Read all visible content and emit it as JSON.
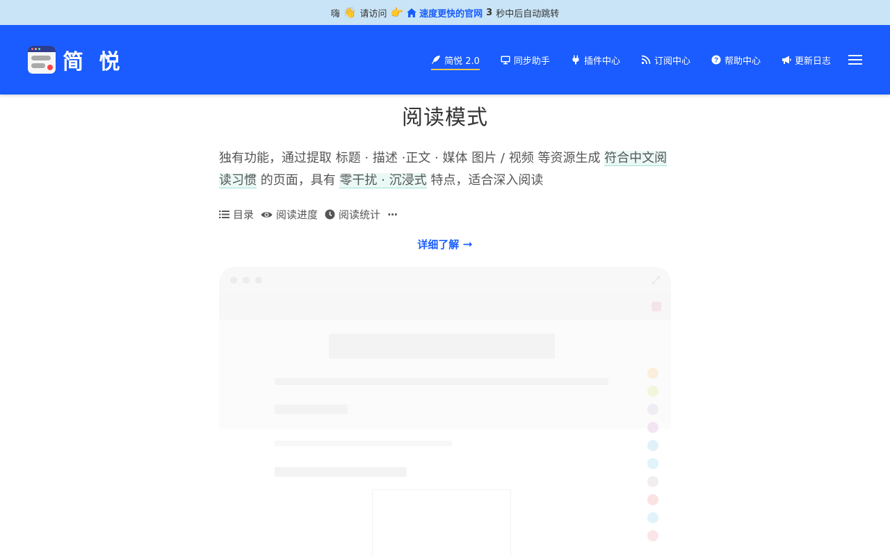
{
  "notice": {
    "greet": "嗨",
    "wave_emoji": "👋",
    "visit": "请访问",
    "point_emoji": "👉",
    "link_text": "速度更快的官网",
    "countdown": "3",
    "suffix": "秒中后自动跳转"
  },
  "brand": {
    "name": "简 悦"
  },
  "nav": {
    "items": [
      {
        "label": "简悦 2.0",
        "icon": "feather-icon"
      },
      {
        "label": "同步助手",
        "icon": "desktop-icon"
      },
      {
        "label": "插件中心",
        "icon": "plug-icon"
      },
      {
        "label": "订阅中心",
        "icon": "rss-icon"
      },
      {
        "label": "帮助中心",
        "icon": "question-circle-icon"
      },
      {
        "label": "更新日志",
        "icon": "megaphone-icon"
      }
    ],
    "active_index": 0
  },
  "page": {
    "title": "阅读模式",
    "desc": {
      "part1": "独有功能，通过提取 标题 · 描述 ·正文 · 媒体 图片 / 视频 等资源生成 ",
      "hl1": "符合中文阅读习惯",
      "part2": " 的页面，具有 ",
      "hl2": "零干扰 · 沉浸式",
      "part3": " 特点，适合深入阅读"
    },
    "features": [
      {
        "label": "目录",
        "icon": "list-icon"
      },
      {
        "label": "阅读进度",
        "icon": "eye-icon"
      },
      {
        "label": "阅读统计",
        "icon": "clock-icon"
      }
    ],
    "more_dots": "···",
    "learn_more": "详细了解",
    "learn_more_arrow": "➞"
  },
  "colors": {
    "notice_bg": "#c9e4f6",
    "header_bg": "#1a5cff",
    "accent": "#1a5dfd",
    "active_underline": "#f7c948",
    "highlight_bg": "#eaf9f6"
  }
}
